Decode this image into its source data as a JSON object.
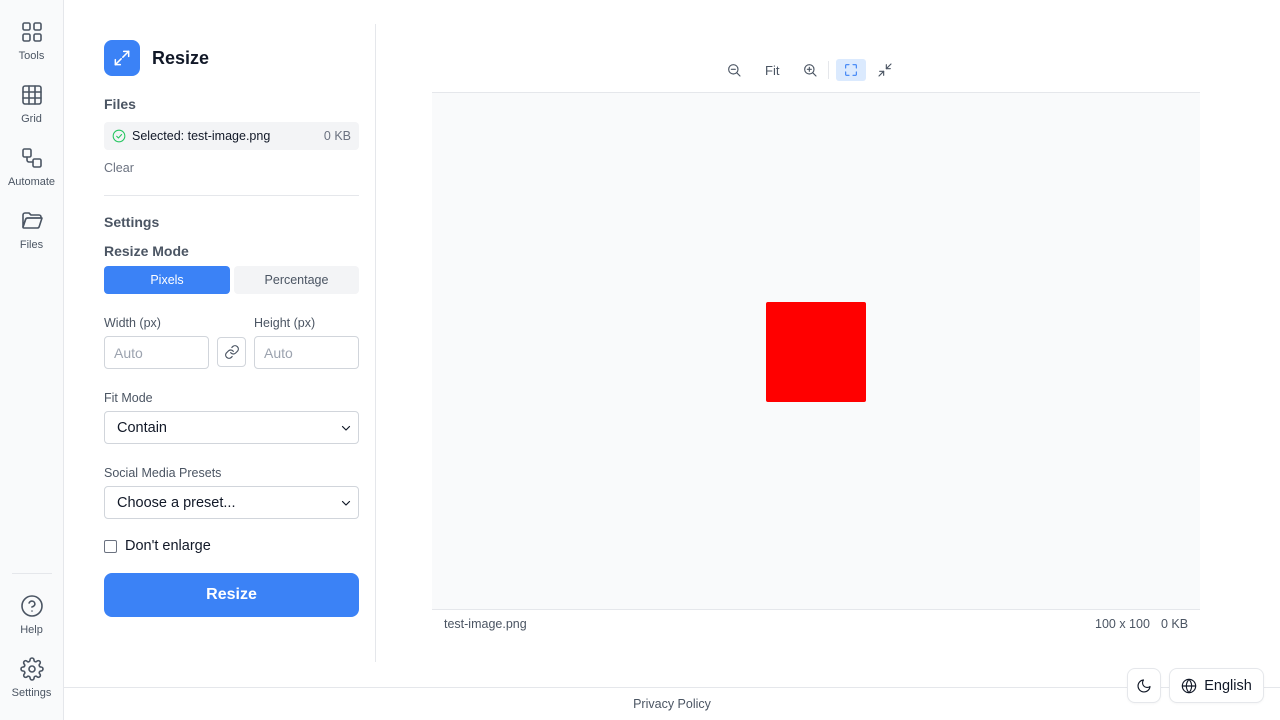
{
  "rail": {
    "items": [
      {
        "label": "Tools",
        "icon": "tools-grid-icon"
      },
      {
        "label": "Grid",
        "icon": "grid-icon"
      },
      {
        "label": "Automate",
        "icon": "automate-icon"
      },
      {
        "label": "Files",
        "icon": "folder-icon"
      }
    ],
    "bottom": [
      {
        "label": "Help",
        "icon": "help-icon"
      },
      {
        "label": "Settings",
        "icon": "gear-icon"
      }
    ]
  },
  "panel": {
    "title": "Resize",
    "files_heading": "Files",
    "selected_file": "Selected: test-image.png",
    "selected_size": "0 KB",
    "clear_label": "Clear",
    "settings_heading": "Settings",
    "resize_mode_heading": "Resize Mode",
    "mode_pixels": "Pixels",
    "mode_percentage": "Percentage",
    "active_mode": "Pixels",
    "width_label": "Width (px)",
    "height_label": "Height (px)",
    "width_placeholder": "Auto",
    "height_placeholder": "Auto",
    "fit_mode_label": "Fit Mode",
    "fit_mode_value": "Contain",
    "presets_label": "Social Media Presets",
    "presets_value": "Choose a preset...",
    "dont_enlarge_label": "Don't enlarge",
    "dont_enlarge_checked": false,
    "submit_label": "Resize"
  },
  "preview": {
    "fit_label": "Fit",
    "image_color": "#ff0000",
    "filename": "test-image.png",
    "dimensions": "100 x 100",
    "size": "0 KB"
  },
  "footer": {
    "privacy_label": "Privacy Policy",
    "language_label": "English"
  },
  "colors": {
    "accent": "#3b82f6",
    "success": "#22c55e"
  }
}
